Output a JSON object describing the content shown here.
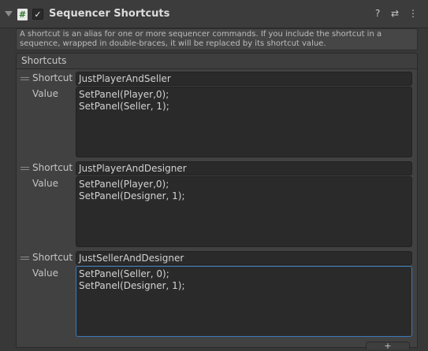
{
  "header": {
    "title": "Sequencer Shortcuts",
    "script_icon_glyph": "#",
    "check_glyph": "✓",
    "icons": [
      "help-icon",
      "presets-icon",
      "more-icon"
    ],
    "help_glyph": "?",
    "presets_glyph": "⇄",
    "more_glyph": "⋮"
  },
  "help_text": "A shortcut is an alias for one or more sequencer commands. If you include the shortcut in a sequence, wrapped in double-braces, it will be replaced by its shortcut value.",
  "list": {
    "title": "Shortcuts",
    "items": [
      {
        "shortcut_label": "Shortcut",
        "shortcut": "JustPlayerAndSeller",
        "value_label": "Value",
        "value": "SetPanel(Player,0);\nSetPanel(Seller, 1);"
      },
      {
        "shortcut_label": "Shortcut",
        "shortcut": "JustPlayerAndDesigner",
        "value_label": "Value",
        "value": "SetPanel(Player,0);\nSetPanel(Designer, 1);"
      },
      {
        "shortcut_label": "Shortcut",
        "shortcut": "JustSellerAndDesigner",
        "value_label": "Value",
        "value": "SetPanel(Seller, 0);\nSetPanel(Designer, 1);"
      }
    ]
  },
  "footer": {
    "add_glyph": "+"
  },
  "colors": {
    "focus": "#3a79bb",
    "background": "#383838",
    "field": "#2a2a2a"
  }
}
